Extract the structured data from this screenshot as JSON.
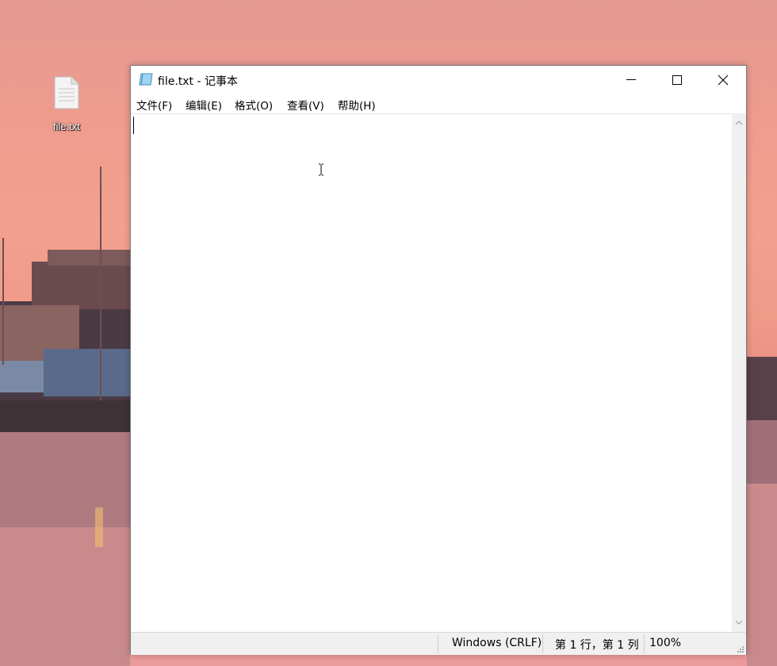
{
  "desktop": {
    "icons": [
      {
        "label": "file.txt",
        "icon": "text-file-icon"
      }
    ]
  },
  "window": {
    "title": "file.txt - 记事本",
    "app_icon": "notepad-icon",
    "controls": {
      "minimize": "minimize-icon",
      "maximize": "maximize-icon",
      "close": "close-icon"
    },
    "menu": [
      {
        "label": "文件(F)"
      },
      {
        "label": "编辑(E)"
      },
      {
        "label": "格式(O)"
      },
      {
        "label": "查看(V)"
      },
      {
        "label": "帮助(H)"
      }
    ],
    "editor": {
      "content": ""
    },
    "statusbar": {
      "line_ending": "Windows (CRLF)",
      "position": "第 1 行，第 1 列",
      "zoom": "100%"
    }
  }
}
